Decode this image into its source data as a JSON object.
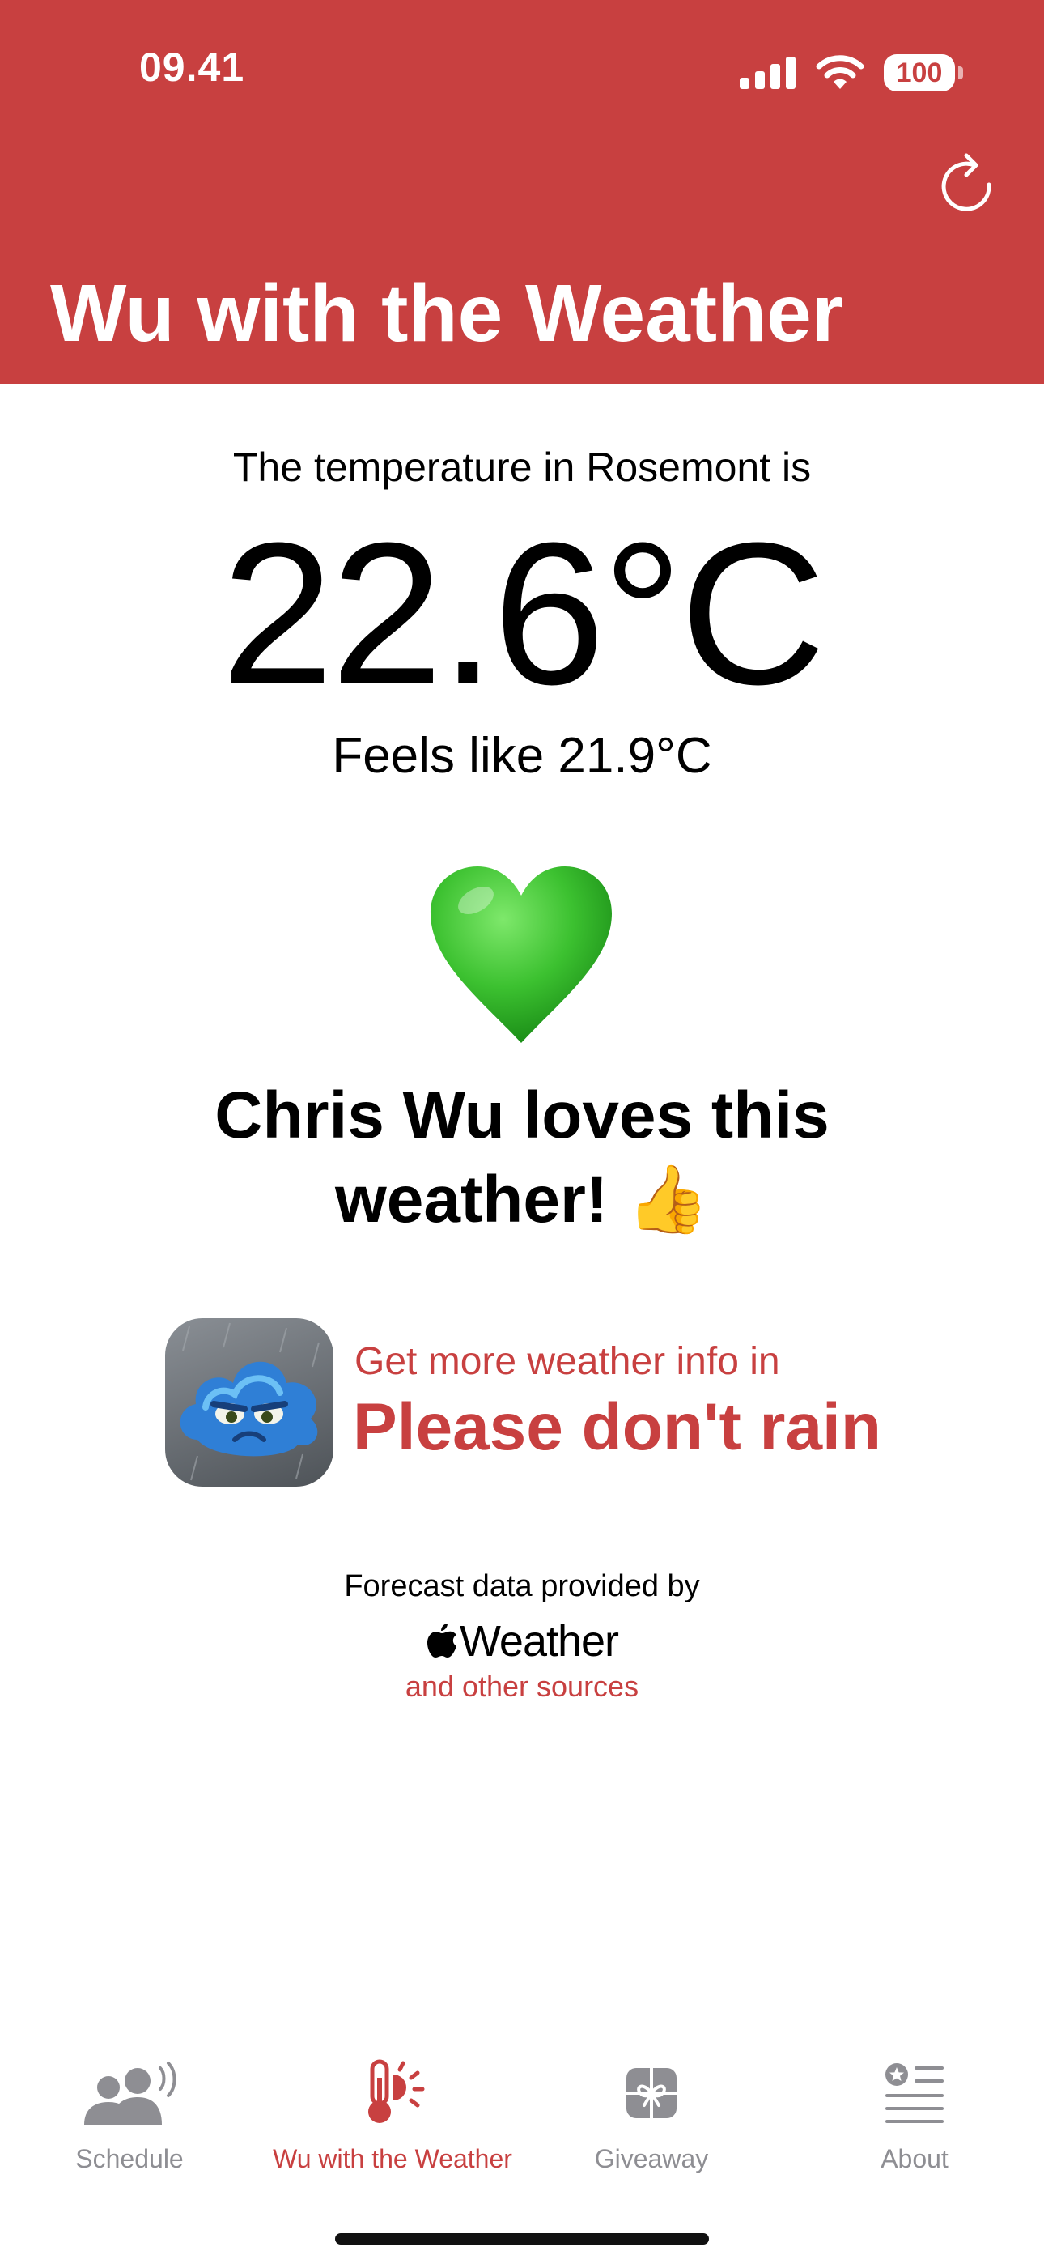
{
  "status_bar": {
    "time": "09.41",
    "battery": "100"
  },
  "header": {
    "title": "Wu with the Weather"
  },
  "weather": {
    "intro": "The temperature in Rosemont is",
    "temperature": "22.6°C",
    "feels_like": "Feels like 21.9°C",
    "verdict_line1": "Chris Wu loves this",
    "verdict_line2": "weather! 👍"
  },
  "promo": {
    "line1": "Get more weather info in",
    "app_name": "Please don't rain"
  },
  "credits": {
    "line1": "Forecast data provided by",
    "brand": "Weather",
    "line2": "and other sources"
  },
  "tabs": [
    {
      "label": "Schedule",
      "icon": "people-icon",
      "active": false
    },
    {
      "label": "Wu with the Weather",
      "icon": "thermometer-sun-icon",
      "active": true
    },
    {
      "label": "Giveaway",
      "icon": "gift-icon",
      "active": false
    },
    {
      "label": "About",
      "icon": "star-list-icon",
      "active": false
    }
  ],
  "colors": {
    "accent": "#c84040",
    "inactive": "#8e8e93"
  }
}
